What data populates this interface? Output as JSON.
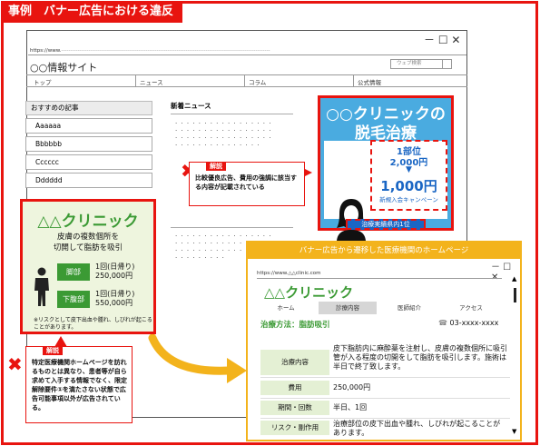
{
  "header": {
    "title": "事例　バナー広告における違反"
  },
  "browser1": {
    "url": "https://www.",
    "window_controls": "－ ☐ ✕",
    "site_name": "○○情報サイト",
    "search_placeholder": "ウェブ検索",
    "nav": [
      "トップ",
      "ニュース",
      "コラム",
      "公式情報"
    ]
  },
  "recommended": {
    "heading": "おすすめの記事",
    "items": [
      "Aaaaaa",
      "Bbbbbb",
      "Cccccc",
      "Dddddd"
    ]
  },
  "news": {
    "heading": "新着ニュース"
  },
  "banner1": {
    "title_line1": "○○クリニックの",
    "title_line2": "脱毛治療",
    "ranking": "1部位",
    "price_before": "2,000円",
    "arrow": "▼",
    "price_after": "1,000円",
    "campaign": "新規入会キャンペーン",
    "footer_badge": "治療実績県内1位",
    "color": "#4aabe0"
  },
  "note1": {
    "badge": "解説",
    "text": "比較優良広告、費用の強調に該当する内容が記載されている"
  },
  "banner2": {
    "title": "△△クリニック",
    "subtitle_line1": "皮膚の複数個所を",
    "subtitle_line2": "切開して脂肪を吸引",
    "options": [
      {
        "label": "脚部",
        "price_line1": "1回(日帰り)",
        "price_line2": "250,000円"
      },
      {
        "label": "下腹部",
        "price_line1": "1回(日帰り)",
        "price_line2": "550,000円"
      }
    ],
    "note": "※リスクとして皮下出血や腫れ、しびれが起こることがあります。",
    "color": "#3b9a34"
  },
  "note2": {
    "badge": "解説",
    "text": "特定医療機関ホームページを訪れるものとは異なり、患者等が自ら求めて入手する情報でなく、限定解除要件①を満たさない状態で広告可能事項以外が広告されている。"
  },
  "browser2": {
    "title": "バナー広告から遷移した医療機関のホームページ",
    "url": "https://www.△△clinic.com",
    "window_controls": "－ ☐ ✕",
    "logo": "△△クリニック",
    "nav": [
      "ホーム",
      "診療内容",
      "医師紹介",
      "アクセス"
    ],
    "subtitle": "治療方法：脂肪吸引",
    "phone": "03-xxxx-xxxx",
    "rows": [
      {
        "label": "治療内容",
        "value": "皮下脂肪内に麻酔薬を注射し、皮膚の複数個所に吸引管が入る程度の切開をして脂肪を吸引します。施術は半日で終了致します。"
      },
      {
        "label": "費用",
        "value": "250,000円"
      },
      {
        "label": "期間・回数",
        "value": "半日、1回"
      },
      {
        "label": "リスク・副作用",
        "value": "治療部位の皮下出血や腫れ、しびれが起こることがあります。"
      }
    ],
    "accent": "#f3b31c"
  }
}
